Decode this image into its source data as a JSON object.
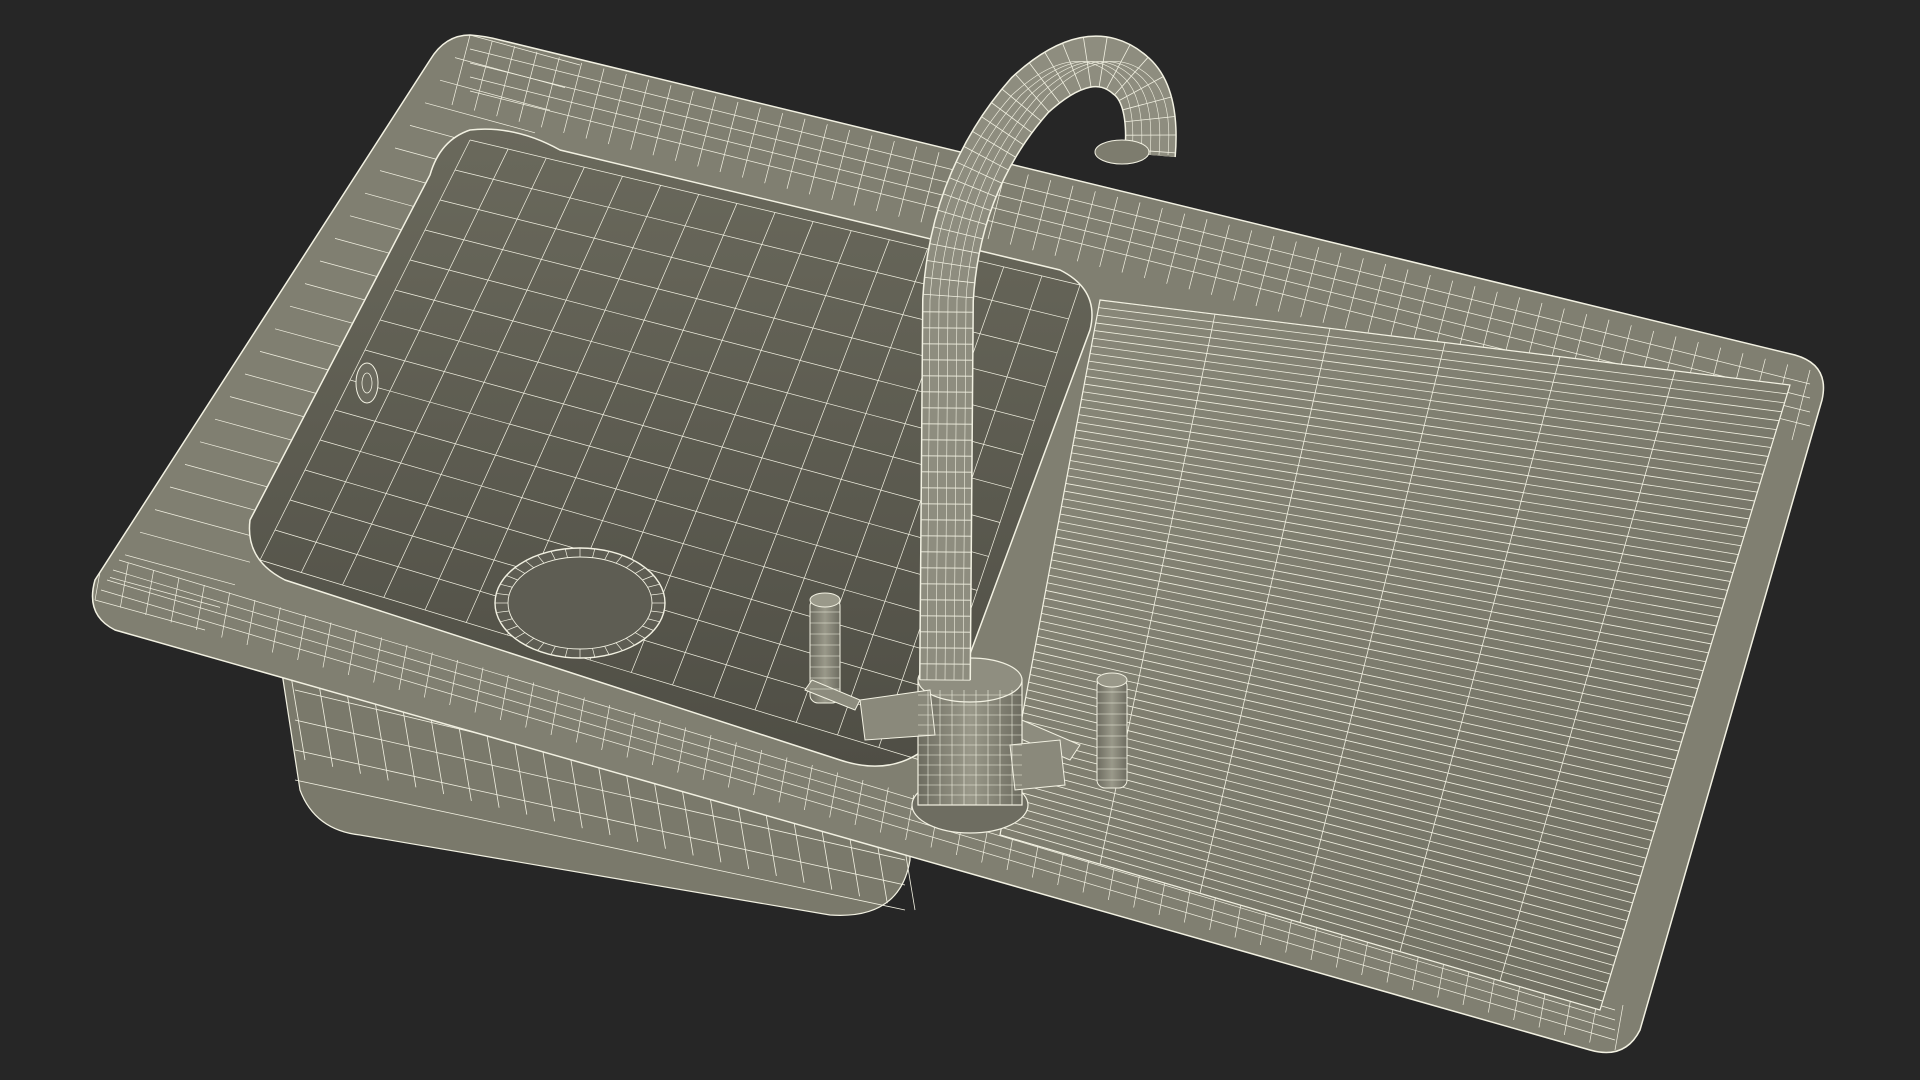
{
  "scene": {
    "background": "#262626",
    "surface_color": "#7d7c6e",
    "surface_dark": "#5a594f",
    "surface_light": "#8e8d7e",
    "wire_color": "#f2f1e2",
    "subject_icon": "wireframe-kitchen-sink-icon"
  }
}
